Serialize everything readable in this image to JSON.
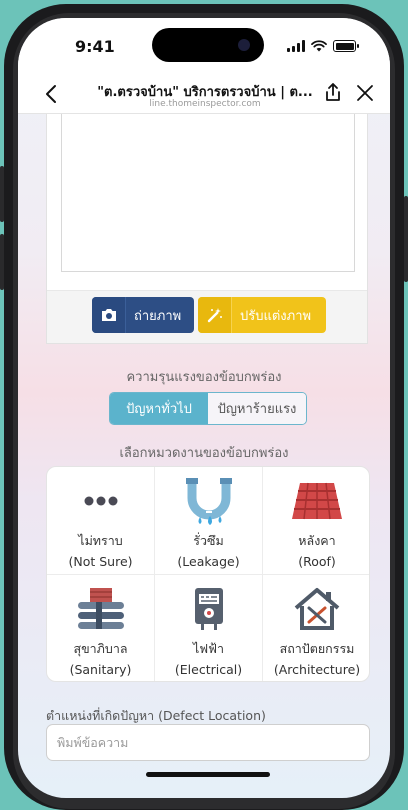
{
  "status_bar": {
    "time": "9:41"
  },
  "header": {
    "title": "\"ต.ตรวจบ้าน\" บริการตรวจบ้าน | ต...",
    "url": "line.thomeinspector.com"
  },
  "photo_actions": {
    "camera_label": "ถ่ายภาพ",
    "edit_label": "ปรับแต่งภาพ"
  },
  "severity": {
    "heading": "ความรุนแรงของข้อบกพร่อง",
    "options": [
      {
        "label": "ปัญหาทั่วไป",
        "selected": true
      },
      {
        "label": "ปัญหาร้ายแรง",
        "selected": false
      }
    ]
  },
  "category": {
    "heading": "เลือกหมวดงานของข้อบกพร่อง",
    "items": [
      {
        "th": "ไม่ทราบ",
        "en": "(Not Sure)",
        "icon": "dots-icon"
      },
      {
        "th": "รั่วซึม",
        "en": "(Leakage)",
        "icon": "leaking-pipe-icon"
      },
      {
        "th": "หลังคา",
        "en": "(Roof)",
        "icon": "roof-tiles-icon"
      },
      {
        "th": "สุขาภิบาล",
        "en": "(Sanitary)",
        "icon": "sanitary-pipes-icon"
      },
      {
        "th": "ไฟฟ้า",
        "en": "(Electrical)",
        "icon": "electric-meter-icon"
      },
      {
        "th": "สถาปัตยกรรม",
        "en": "(Architecture)",
        "icon": "house-tools-icon"
      }
    ]
  },
  "defect_location": {
    "label": "ตำแหน่งที่เกิดปัญหา (Defect Location)",
    "placeholder": "พิมพ์ข้อความ",
    "value": ""
  },
  "colors": {
    "background": "#6cc3b9",
    "camera_button": "#2d4e85",
    "edit_button": "#f1c31a",
    "segment_active": "#5bb3cc"
  }
}
